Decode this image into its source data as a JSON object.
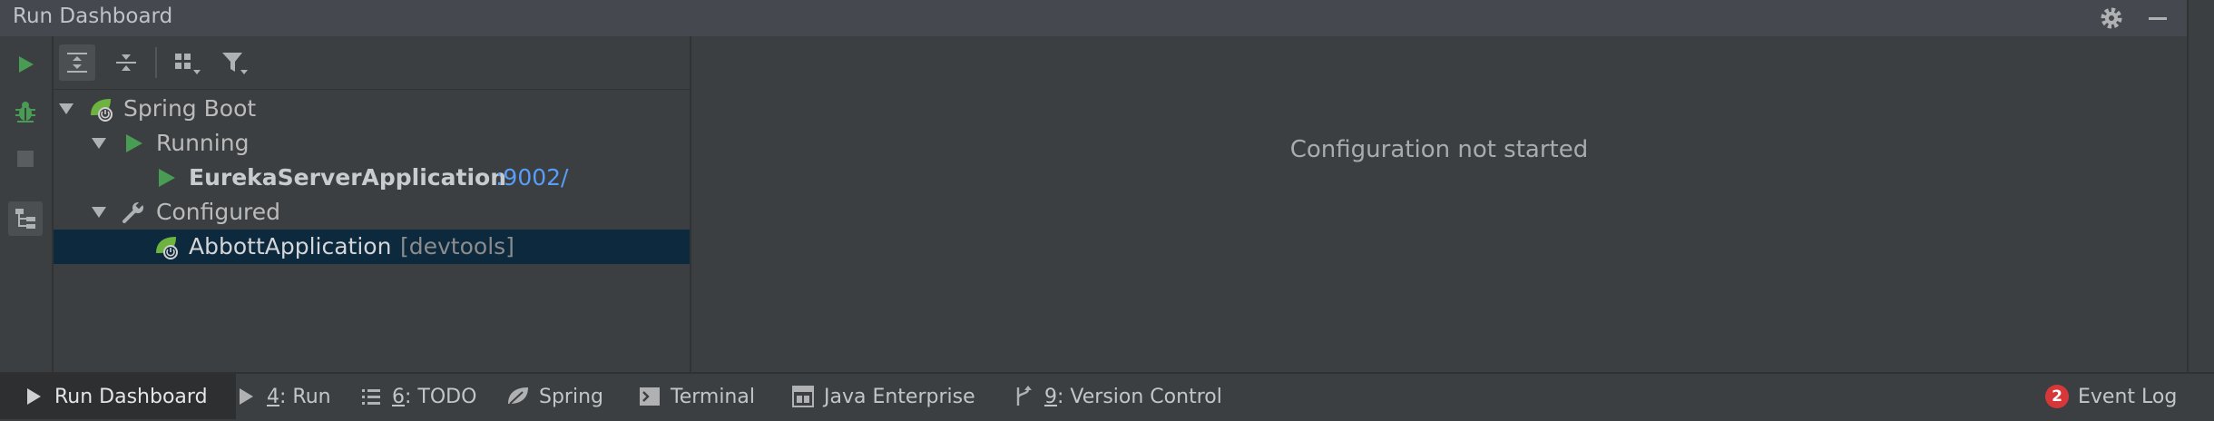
{
  "window": {
    "title": "Run Dashboard"
  },
  "tree": {
    "groups": [
      {
        "label": "Spring Boot",
        "icon": "spring-boot-icon",
        "children": [
          {
            "label": "Running",
            "icon": "run-icon",
            "items": [
              {
                "name": "EurekaServerApplication",
                "port": ":9002/"
              }
            ]
          },
          {
            "label": "Configured",
            "icon": "wrench-icon",
            "items": [
              {
                "name": "AbbottApplication",
                "hint": "[devtools]"
              }
            ]
          }
        ]
      }
    ]
  },
  "detail": {
    "empty_text": "Configuration not started"
  },
  "bottom_tabs": [
    {
      "label": "Run Dashboard",
      "icon": "run-icon",
      "active": true
    },
    {
      "mnemonic": "4",
      "label": ": Run",
      "icon": "run-icon"
    },
    {
      "mnemonic": "6",
      "label": ": TODO",
      "icon": "list-icon"
    },
    {
      "label": "Spring",
      "icon": "spring-leaf-icon"
    },
    {
      "label": "Terminal",
      "icon": "terminal-icon"
    },
    {
      "label": "Java Enterprise",
      "icon": "java-enterprise-icon"
    },
    {
      "mnemonic": "9",
      "label": ": Version Control",
      "icon": "vcs-icon"
    }
  ],
  "event_log": {
    "label": "Event Log",
    "count": "2"
  },
  "colors": {
    "accent_green": "#499c54",
    "link_blue": "#589df6",
    "selection": "#0d293e",
    "badge_red": "#d6383a"
  }
}
